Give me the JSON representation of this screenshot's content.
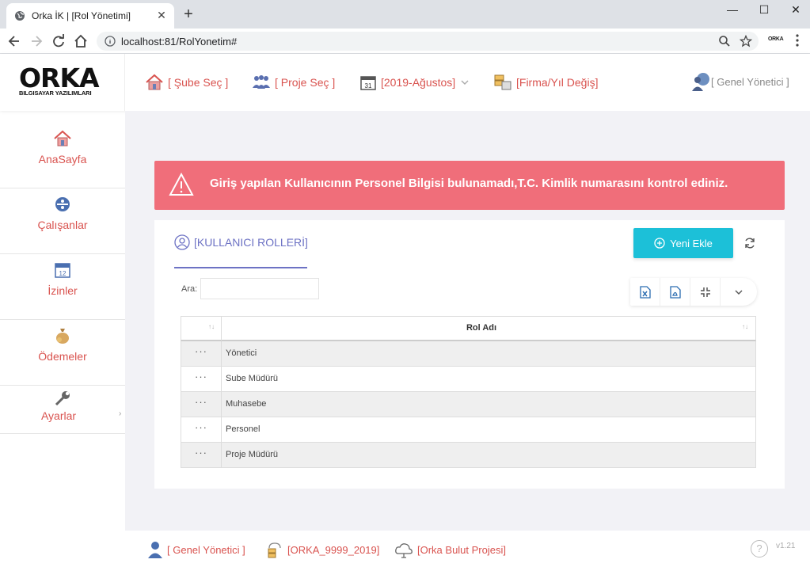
{
  "browser": {
    "tab_title": "Orka İK | [Rol Yönetimi]",
    "tab_close": "✕",
    "new_tab": "+",
    "url": "localhost:81/RolYonetim#",
    "extension_label": "ORKA",
    "window_controls": {
      "minimize": "—",
      "maximize": "☐",
      "close": "✕"
    }
  },
  "header": {
    "logo": "ORKA",
    "logo_subtitle": "BILGISAYAR YAZILIMLARI",
    "nav": {
      "branch": "[ Şube Seç ]",
      "project": "[ Proje Seç ]",
      "period": "[2019-Ağustos]",
      "company": "[Firma/Yıl Değiş]"
    },
    "user": "[ Genel Yönetici ]"
  },
  "sidebar": {
    "items": [
      {
        "label": "AnaSayfa",
        "icon": "home-icon"
      },
      {
        "label": "Çalışanlar",
        "icon": "employees-icon"
      },
      {
        "label": "İzinler",
        "icon": "calendar-icon"
      },
      {
        "label": "Ödemeler",
        "icon": "money-bag-icon"
      },
      {
        "label": "Ayarlar",
        "icon": "wrench-icon"
      }
    ],
    "expand_arrow": "›"
  },
  "alert": {
    "text": "Giriş yapılan Kullanıcının Personel Bilgisi bulunamadı,T.C. Kimlik numarasını kontrol ediniz."
  },
  "panel": {
    "title": "[KULLANICI ROLLERİ]",
    "new_button": "Yeni Ekle",
    "search_label": "Ara:",
    "search_value": "",
    "grid": {
      "column_header": "Rol Adı",
      "sort_glyph": "↑↓",
      "row_menu": "···",
      "rows": [
        "Yönetici",
        "Sube Müdürü",
        "Muhasebe",
        "Personel",
        "Proje Müdürü"
      ]
    }
  },
  "footer": {
    "user": "[ Genel Yönetici ]",
    "database": "[ORKA_9999_2019]",
    "project": "[Orka Bulut Projesi]",
    "help": "?",
    "version": "v1.21"
  },
  "colors": {
    "accent_red": "#d9534f",
    "alert_bg": "#f06e7a",
    "primary_cyan": "#1cc0d8",
    "title_purple": "#6d72c4"
  }
}
